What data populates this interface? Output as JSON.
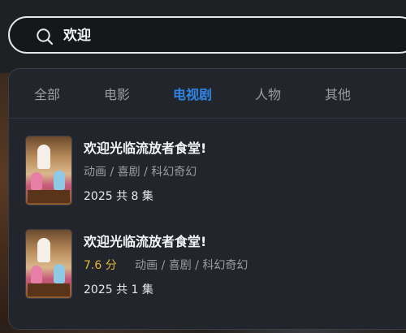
{
  "search": {
    "value": "欢迎",
    "icon": "search-icon"
  },
  "tabs": [
    {
      "label": "全部",
      "active": false
    },
    {
      "label": "电影",
      "active": false
    },
    {
      "label": "电视剧",
      "active": true
    },
    {
      "label": "人物",
      "active": false
    },
    {
      "label": "其他",
      "active": false
    }
  ],
  "colors": {
    "accent": "#2f86e6",
    "rating": "#e3b93a",
    "panel_bg": "#22252b"
  },
  "results": [
    {
      "title": "欢迎光临流放者食堂!",
      "rating": "",
      "genres": "动画 / 喜剧 / 科幻奇幻",
      "episodes": "2025 共 8 集"
    },
    {
      "title": "欢迎光临流放者食堂!",
      "rating": "7.6 分",
      "genres": "动画 / 喜剧 / 科幻奇幻",
      "episodes": "2025 共 1 集"
    }
  ]
}
